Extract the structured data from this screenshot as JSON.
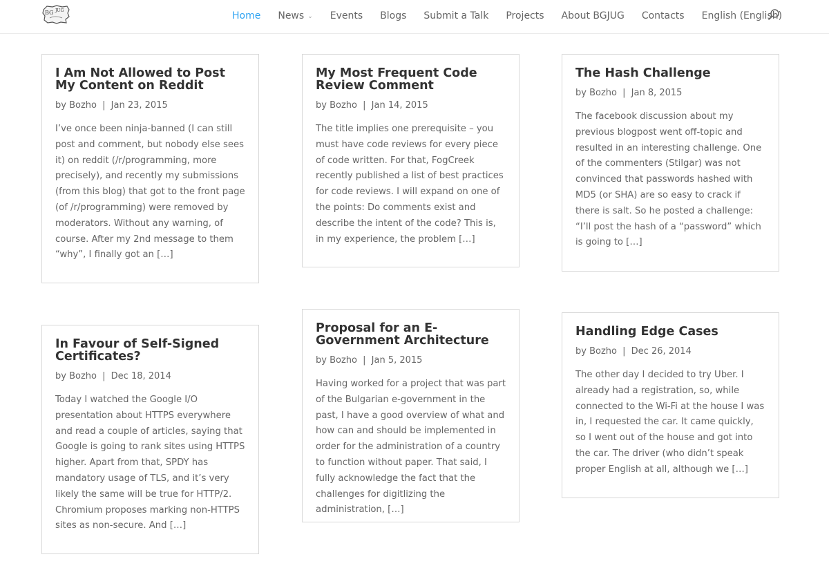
{
  "nav": {
    "items": [
      {
        "label": "Home",
        "active": true,
        "has_dropdown": false
      },
      {
        "label": "News",
        "active": false,
        "has_dropdown": true
      },
      {
        "label": "Events",
        "active": false,
        "has_dropdown": false
      },
      {
        "label": "Blogs",
        "active": false,
        "has_dropdown": false
      },
      {
        "label": "Submit a Talk",
        "active": false,
        "has_dropdown": false
      },
      {
        "label": "Projects",
        "active": false,
        "has_dropdown": false
      },
      {
        "label": "About BGJUG",
        "active": false,
        "has_dropdown": false
      },
      {
        "label": "Contacts",
        "active": false,
        "has_dropdown": false
      },
      {
        "label": "English (English)",
        "active": false,
        "has_dropdown": false
      }
    ],
    "search_icon": "search-icon",
    "active_color": "#2ea3f2"
  },
  "logo": {
    "text": "BG JUG"
  },
  "posts": [
    {
      "title": "I Am Not Allowed to Post My Content on Reddit",
      "by": "by",
      "author": "Bozho",
      "separator": "|",
      "date": "Jan 23, 2015",
      "excerpt": "I’ve once been ninja-banned (I can still post and comment, but nobody else sees it) on reddit (/r/programming, more precisely), and recently my submissions (from this blog) that got to the front page (of /r/programming) were removed by moderators. Without any warning, of course. After my 2nd message to them “why”, I finally got an […]"
    },
    {
      "title": "My Most Frequent Code Review Comment",
      "by": "by",
      "author": "Bozho",
      "separator": "|",
      "date": "Jan 14, 2015",
      "excerpt": "The title implies one prerequisite – you must have code reviews for every piece of code written. For that, FogCreek recently published a list of best practices for code reviews. I will expand on one of the points: Do comments exist and describe the intent of the code? This is, in my experience, the problem […]"
    },
    {
      "title": "The Hash Challenge",
      "by": "by",
      "author": "Bozho",
      "separator": "|",
      "date": "Jan 8, 2015",
      "excerpt": "The facebook discussion about my previous blogpost went off-topic and resulted in an interesting challenge. One of the commenters (Stilgar) was not convinced that passwords hashed with MD5 (or SHA) are so easy to crack if there is salt. So he posted a challenge: “I’ll post the hash of a “password” which is going to […]"
    },
    {
      "title": "In Favour of Self-Signed Certificates?",
      "by": "by",
      "author": "Bozho",
      "separator": "|",
      "date": "Dec 18, 2014",
      "excerpt": "Today I watched the Google I/O presentation about HTTPS everywhere and read a couple of articles, saying that Google is going to rank sites using HTTPS higher. Apart from that, SPDY has mandatory usage of TLS, and it’s very likely the same will be true for HTTP/2. Chromium proposes marking non-HTTPS sites as non-secure. And […]"
    },
    {
      "title": "Proposal for an E-Government Architecture",
      "by": "by",
      "author": "Bozho",
      "separator": "|",
      "date": "Jan 5, 2015",
      "excerpt": "Having worked for a project that was part of the Bulgarian e-government in the past, I have a good overview of what and how can and should be implemented in order for the administration of a country to function without paper. That said, I fully acknowledge the fact that the challenges for digitlizing the administration, […]"
    },
    {
      "title": "Handling Edge Cases",
      "by": "by",
      "author": "Bozho",
      "separator": "|",
      "date": "Dec 26, 2014",
      "excerpt": "The other day I decided to try Uber. I already had a registration, so, while connected to the Wi-Fi at the house I was in, I requested the car. It came quickly, so I went out of the house and got into the car. The driver (who didn’t speak proper English at all, although we […]"
    }
  ]
}
